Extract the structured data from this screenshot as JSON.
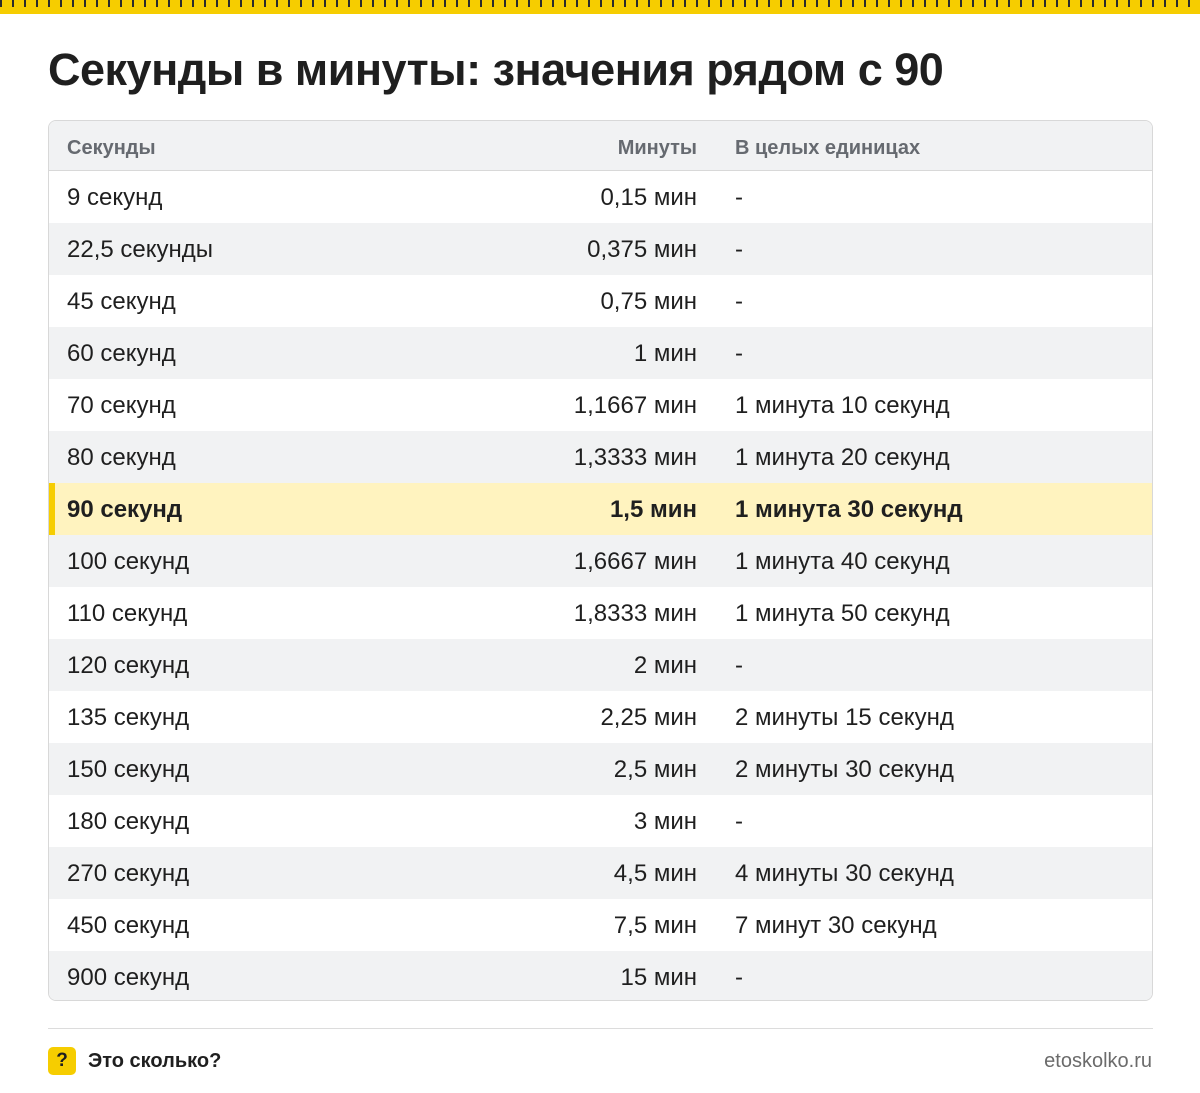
{
  "title": "Секунды в минуты: значения рядом с 90",
  "colors": {
    "accent": "#f6cd00",
    "highlight_row": "#fff3bf",
    "alt_row": "#f1f2f3"
  },
  "table": {
    "headers": [
      "Секунды",
      "Минуты",
      "В целых единицах"
    ],
    "highlight_row_index": 6,
    "rows": [
      [
        "9 секунд",
        "0,15 мин",
        "-"
      ],
      [
        "22,5 секунды",
        "0,375 мин",
        "-"
      ],
      [
        "45 секунд",
        "0,75 мин",
        "-"
      ],
      [
        "60 секунд",
        "1 мин",
        "-"
      ],
      [
        "70 секунд",
        "1,1667 мин",
        "1 минута 10 секунд"
      ],
      [
        "80 секунд",
        "1,3333 мин",
        "1 минута 20 секунд"
      ],
      [
        "90 секунд",
        "1,5 мин",
        "1 минута 30 секунд"
      ],
      [
        "100 секунд",
        "1,6667 мин",
        "1 минута 40 секунд"
      ],
      [
        "110 секунд",
        "1,8333 мин",
        "1 минута 50 секунд"
      ],
      [
        "120 секунд",
        "2 мин",
        "-"
      ],
      [
        "135 секунд",
        "2,25 мин",
        "2 минуты 15 секунд"
      ],
      [
        "150 секунд",
        "2,5 мин",
        "2 минуты 30 секунд"
      ],
      [
        "180 секунд",
        "3 мин",
        "-"
      ],
      [
        "270 секунд",
        "4,5 мин",
        "4 минуты 30 секунд"
      ],
      [
        "450 секунд",
        "7,5 мин",
        "7 минут 30 секунд"
      ],
      [
        "900 секунд",
        "15 мин",
        "-"
      ]
    ]
  },
  "footer": {
    "logo_glyph": "?",
    "brand": "Это сколько?",
    "site": "etoskolko.ru"
  }
}
